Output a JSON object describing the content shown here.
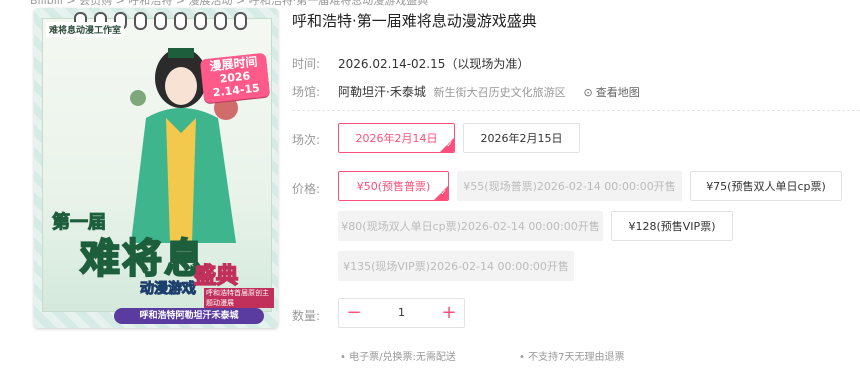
{
  "breadcrumb": "Bilibili > 会员购 > 呼和浩特 > 漫展活动 > 呼和浩特·第一届难将息动漫游戏盛典",
  "poster": {
    "studio": "难将息动漫工作室",
    "date_badge": [
      "漫展时间",
      "2026",
      "2.14-15"
    ],
    "title_prefix": "第一届",
    "title_main": "难将息",
    "title_suffix": "盛典",
    "title_sub": "动漫游戏",
    "small_tag": "呼和浩特首届原创主题动漫展",
    "venue": "呼和浩特阿勒坦汗禾泰城"
  },
  "event": {
    "title": "呼和浩特·第一届难将息动漫游戏盛典",
    "time_label": "时间:",
    "time_value": "2026.02.14-02.15（以现场为准）",
    "venue_label": "场馆:",
    "venue_name": "阿勒坦汗·禾泰城",
    "venue_district": "新生街大召历史文化旅游区",
    "map_link": "查看地图"
  },
  "session": {
    "label": "场次:",
    "options": [
      {
        "label": "2026年2月14日",
        "state": "selected"
      },
      {
        "label": "2026年2月15日",
        "state": "normal"
      }
    ]
  },
  "price": {
    "label": "价格:",
    "options": [
      {
        "label": "¥50(预售普票)",
        "state": "selected"
      },
      {
        "label": "¥55(现场普票)2026-02-14 00:00:00开售",
        "state": "disabled"
      },
      {
        "label": "¥75(预售双人单日cp票)",
        "state": "normal"
      },
      {
        "label": "¥80(现场双人单日cp票)2026-02-14 00:00:00开售",
        "state": "disabled"
      },
      {
        "label": "¥128(预售VIP票)",
        "state": "normal"
      },
      {
        "label": "¥135(现场VIP票)2026-02-14 00:00:00开售",
        "state": "disabled"
      }
    ]
  },
  "quantity": {
    "label": "数量:",
    "value": "1",
    "minus": "−",
    "plus": "+"
  },
  "notes": [
    "电子票/兑换票:无需配送",
    "不支持7天无理由退票"
  ],
  "colors": {
    "accent": "#ff4f7a",
    "muted": "#999999"
  }
}
